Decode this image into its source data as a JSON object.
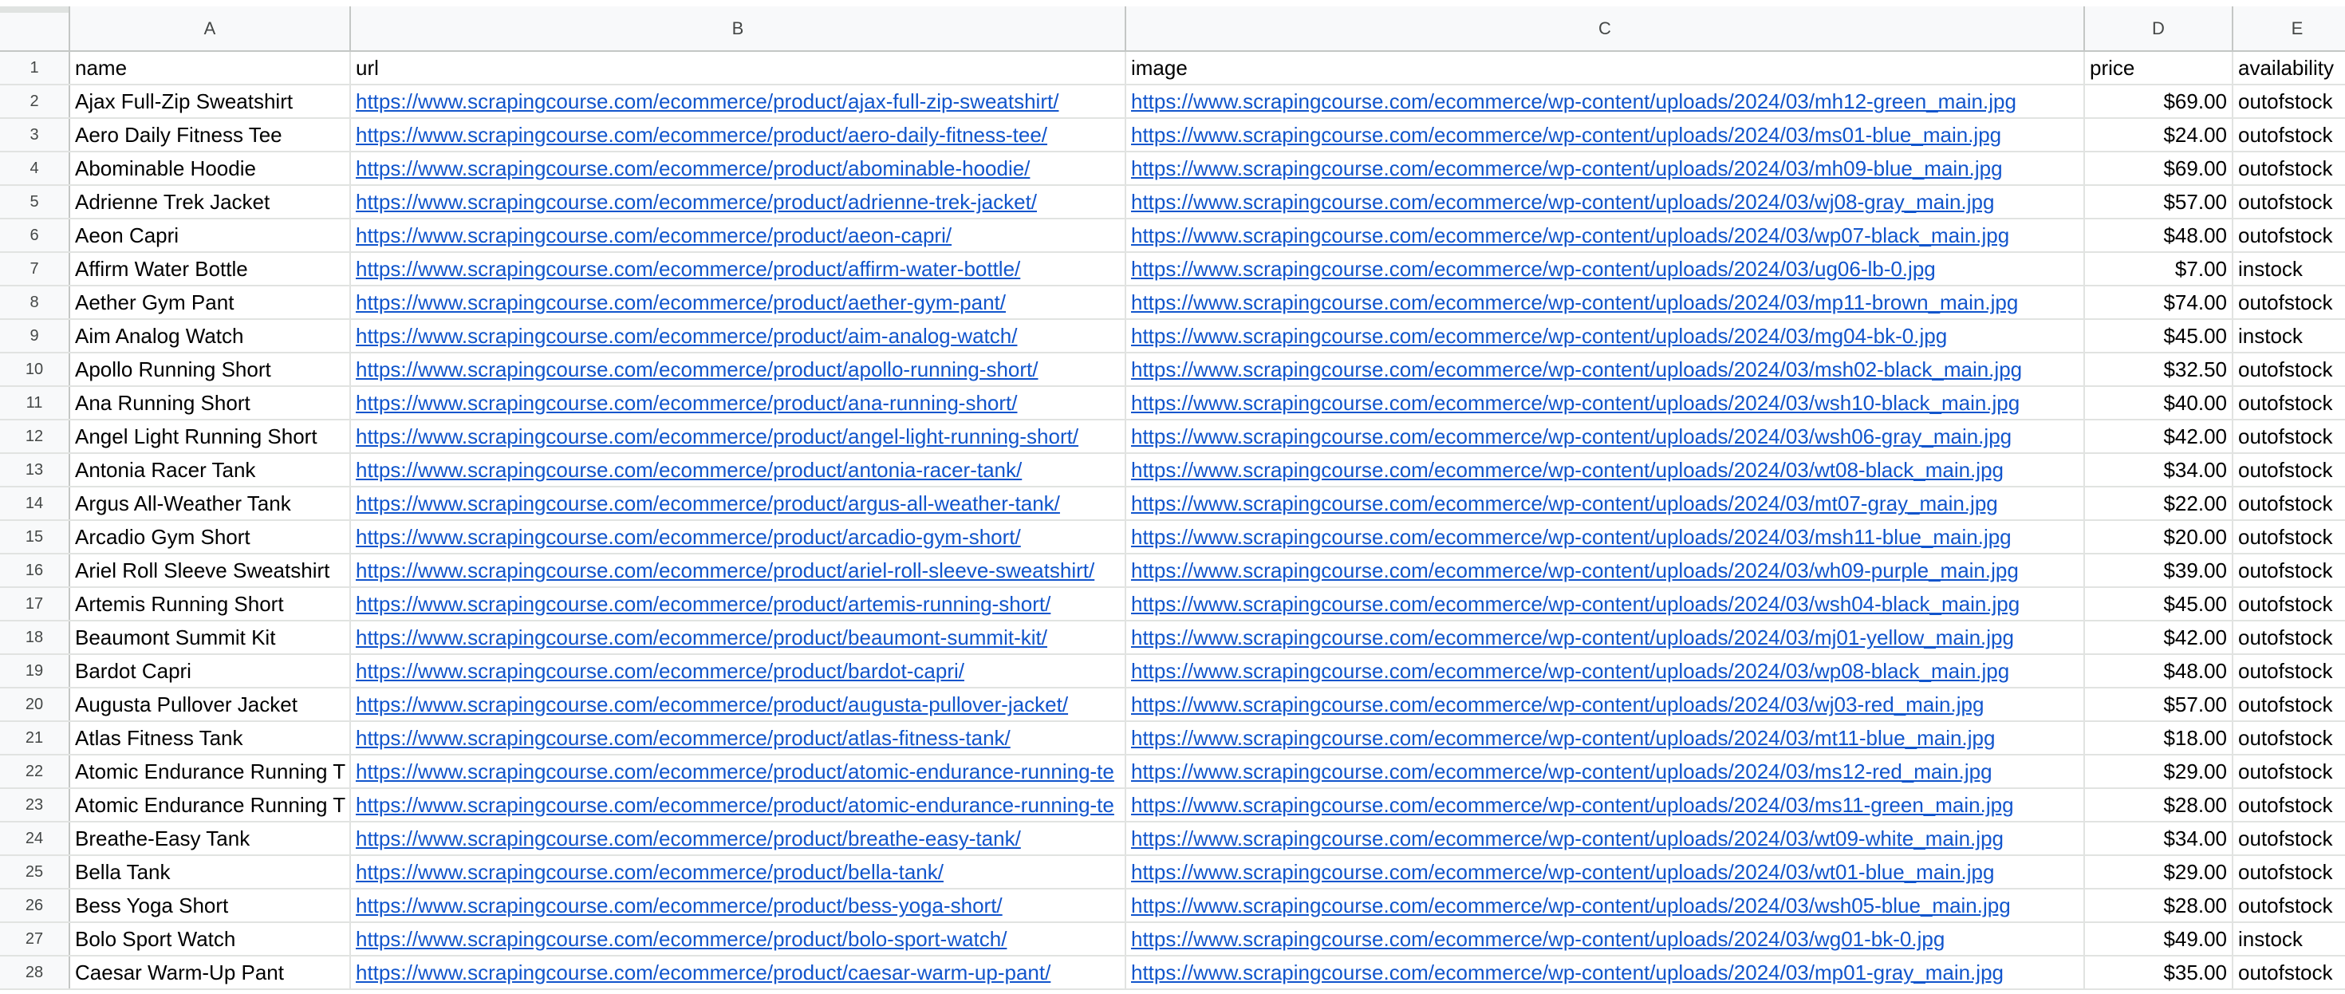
{
  "columns": [
    "A",
    "B",
    "C",
    "D",
    "E"
  ],
  "rows": [
    {
      "num": "1",
      "name": "name",
      "url": "url",
      "image": "image",
      "price": "price",
      "availability": "availability",
      "header": true
    },
    {
      "num": "2",
      "name": "Ajax Full-Zip Sweatshirt",
      "url": "https://www.scrapingcourse.com/ecommerce/product/ajax-full-zip-sweatshirt/",
      "image": "https://www.scrapingcourse.com/ecommerce/wp-content/uploads/2024/03/mh12-green_main.jpg",
      "price": "$69.00",
      "availability": "outofstock"
    },
    {
      "num": "3",
      "name": "Aero Daily Fitness Tee",
      "url": "https://www.scrapingcourse.com/ecommerce/product/aero-daily-fitness-tee/",
      "image": "https://www.scrapingcourse.com/ecommerce/wp-content/uploads/2024/03/ms01-blue_main.jpg",
      "price": "$24.00",
      "availability": "outofstock"
    },
    {
      "num": "4",
      "name": "Abominable Hoodie",
      "url": "https://www.scrapingcourse.com/ecommerce/product/abominable-hoodie/",
      "image": "https://www.scrapingcourse.com/ecommerce/wp-content/uploads/2024/03/mh09-blue_main.jpg",
      "price": "$69.00",
      "availability": "outofstock"
    },
    {
      "num": "5",
      "name": "Adrienne Trek Jacket",
      "url": "https://www.scrapingcourse.com/ecommerce/product/adrienne-trek-jacket/",
      "image": "https://www.scrapingcourse.com/ecommerce/wp-content/uploads/2024/03/wj08-gray_main.jpg",
      "price": "$57.00",
      "availability": "outofstock"
    },
    {
      "num": "6",
      "name": "Aeon Capri",
      "url": "https://www.scrapingcourse.com/ecommerce/product/aeon-capri/",
      "image": "https://www.scrapingcourse.com/ecommerce/wp-content/uploads/2024/03/wp07-black_main.jpg",
      "price": "$48.00",
      "availability": "outofstock"
    },
    {
      "num": "7",
      "name": "Affirm Water Bottle",
      "url": "https://www.scrapingcourse.com/ecommerce/product/affirm-water-bottle/",
      "image": "https://www.scrapingcourse.com/ecommerce/wp-content/uploads/2024/03/ug06-lb-0.jpg",
      "price": "$7.00",
      "availability": "instock"
    },
    {
      "num": "8",
      "name": "Aether Gym Pant",
      "url": "https://www.scrapingcourse.com/ecommerce/product/aether-gym-pant/",
      "image": "https://www.scrapingcourse.com/ecommerce/wp-content/uploads/2024/03/mp11-brown_main.jpg",
      "price": "$74.00",
      "availability": "outofstock"
    },
    {
      "num": "9",
      "name": "Aim Analog Watch",
      "url": "https://www.scrapingcourse.com/ecommerce/product/aim-analog-watch/",
      "image": "https://www.scrapingcourse.com/ecommerce/wp-content/uploads/2024/03/mg04-bk-0.jpg",
      "price": "$45.00",
      "availability": "instock"
    },
    {
      "num": "10",
      "name": "Apollo Running Short",
      "url": "https://www.scrapingcourse.com/ecommerce/product/apollo-running-short/",
      "image": "https://www.scrapingcourse.com/ecommerce/wp-content/uploads/2024/03/msh02-black_main.jpg",
      "price": "$32.50",
      "availability": "outofstock"
    },
    {
      "num": "11",
      "name": "Ana Running Short",
      "url": "https://www.scrapingcourse.com/ecommerce/product/ana-running-short/",
      "image": "https://www.scrapingcourse.com/ecommerce/wp-content/uploads/2024/03/wsh10-black_main.jpg",
      "price": "$40.00",
      "availability": "outofstock"
    },
    {
      "num": "12",
      "name": "Angel Light Running Short",
      "url": "https://www.scrapingcourse.com/ecommerce/product/angel-light-running-short/",
      "image": "https://www.scrapingcourse.com/ecommerce/wp-content/uploads/2024/03/wsh06-gray_main.jpg",
      "price": "$42.00",
      "availability": "outofstock"
    },
    {
      "num": "13",
      "name": "Antonia Racer Tank",
      "url": "https://www.scrapingcourse.com/ecommerce/product/antonia-racer-tank/",
      "image": "https://www.scrapingcourse.com/ecommerce/wp-content/uploads/2024/03/wt08-black_main.jpg",
      "price": "$34.00",
      "availability": "outofstock"
    },
    {
      "num": "14",
      "name": "Argus All-Weather Tank",
      "url": "https://www.scrapingcourse.com/ecommerce/product/argus-all-weather-tank/",
      "image": "https://www.scrapingcourse.com/ecommerce/wp-content/uploads/2024/03/mt07-gray_main.jpg",
      "price": "$22.00",
      "availability": "outofstock"
    },
    {
      "num": "15",
      "name": "Arcadio Gym Short",
      "url": "https://www.scrapingcourse.com/ecommerce/product/arcadio-gym-short/",
      "image": "https://www.scrapingcourse.com/ecommerce/wp-content/uploads/2024/03/msh11-blue_main.jpg",
      "price": "$20.00",
      "availability": "outofstock"
    },
    {
      "num": "16",
      "name": "Ariel Roll Sleeve Sweatshirt",
      "url": "https://www.scrapingcourse.com/ecommerce/product/ariel-roll-sleeve-sweatshirt/",
      "image": "https://www.scrapingcourse.com/ecommerce/wp-content/uploads/2024/03/wh09-purple_main.jpg",
      "price": "$39.00",
      "availability": "outofstock"
    },
    {
      "num": "17",
      "name": "Artemis Running Short",
      "url": "https://www.scrapingcourse.com/ecommerce/product/artemis-running-short/",
      "image": "https://www.scrapingcourse.com/ecommerce/wp-content/uploads/2024/03/wsh04-black_main.jpg",
      "price": "$45.00",
      "availability": "outofstock"
    },
    {
      "num": "18",
      "name": "Beaumont Summit Kit",
      "url": "https://www.scrapingcourse.com/ecommerce/product/beaumont-summit-kit/",
      "image": "https://www.scrapingcourse.com/ecommerce/wp-content/uploads/2024/03/mj01-yellow_main.jpg",
      "price": "$42.00",
      "availability": "outofstock"
    },
    {
      "num": "19",
      "name": "Bardot Capri",
      "url": "https://www.scrapingcourse.com/ecommerce/product/bardot-capri/",
      "image": "https://www.scrapingcourse.com/ecommerce/wp-content/uploads/2024/03/wp08-black_main.jpg",
      "price": "$48.00",
      "availability": "outofstock"
    },
    {
      "num": "20",
      "name": "Augusta Pullover Jacket",
      "url": "https://www.scrapingcourse.com/ecommerce/product/augusta-pullover-jacket/",
      "image": "https://www.scrapingcourse.com/ecommerce/wp-content/uploads/2024/03/wj03-red_main.jpg",
      "price": "$57.00",
      "availability": "outofstock"
    },
    {
      "num": "21",
      "name": "Atlas Fitness Tank",
      "url": "https://www.scrapingcourse.com/ecommerce/product/atlas-fitness-tank/",
      "image": "https://www.scrapingcourse.com/ecommerce/wp-content/uploads/2024/03/mt11-blue_main.jpg",
      "price": "$18.00",
      "availability": "outofstock"
    },
    {
      "num": "22",
      "name": "Atomic Endurance Running T",
      "url": "https://www.scrapingcourse.com/ecommerce/product/atomic-endurance-running-te",
      "image": "https://www.scrapingcourse.com/ecommerce/wp-content/uploads/2024/03/ms12-red_main.jpg",
      "price": "$29.00",
      "availability": "outofstock"
    },
    {
      "num": "23",
      "name": "Atomic Endurance Running T",
      "url": "https://www.scrapingcourse.com/ecommerce/product/atomic-endurance-running-te",
      "image": "https://www.scrapingcourse.com/ecommerce/wp-content/uploads/2024/03/ms11-green_main.jpg",
      "price": "$28.00",
      "availability": "outofstock"
    },
    {
      "num": "24",
      "name": "Breathe-Easy Tank",
      "url": "https://www.scrapingcourse.com/ecommerce/product/breathe-easy-tank/",
      "image": "https://www.scrapingcourse.com/ecommerce/wp-content/uploads/2024/03/wt09-white_main.jpg",
      "price": "$34.00",
      "availability": "outofstock"
    },
    {
      "num": "25",
      "name": "Bella Tank",
      "url": "https://www.scrapingcourse.com/ecommerce/product/bella-tank/",
      "image": "https://www.scrapingcourse.com/ecommerce/wp-content/uploads/2024/03/wt01-blue_main.jpg",
      "price": "$29.00",
      "availability": "outofstock"
    },
    {
      "num": "26",
      "name": "Bess Yoga Short",
      "url": "https://www.scrapingcourse.com/ecommerce/product/bess-yoga-short/",
      "image": "https://www.scrapingcourse.com/ecommerce/wp-content/uploads/2024/03/wsh05-blue_main.jpg",
      "price": "$28.00",
      "availability": "outofstock"
    },
    {
      "num": "27",
      "name": "Bolo Sport Watch",
      "url": "https://www.scrapingcourse.com/ecommerce/product/bolo-sport-watch/",
      "image": "https://www.scrapingcourse.com/ecommerce/wp-content/uploads/2024/03/wg01-bk-0.jpg",
      "price": "$49.00",
      "availability": "instock"
    },
    {
      "num": "28",
      "name": "Caesar Warm-Up Pant",
      "url": "https://www.scrapingcourse.com/ecommerce/product/caesar-warm-up-pant/",
      "image": "https://www.scrapingcourse.com/ecommerce/wp-content/uploads/2024/03/mp01-gray_main.jpg",
      "price": "$35.00",
      "availability": "outofstock"
    }
  ]
}
